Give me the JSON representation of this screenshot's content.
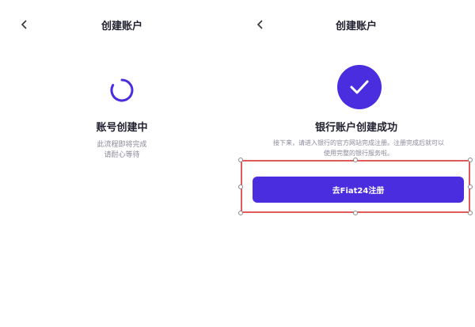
{
  "left_screen": {
    "back_icon": "chevron-left-icon",
    "title": "创建账户",
    "spinner_icon": "loading-spinner-icon",
    "status_title": "账号创建中",
    "desc_line1": "此流程即将完成",
    "desc_line2": "请耐心等待"
  },
  "right_screen": {
    "back_icon": "chevron-left-icon",
    "title": "创建账户",
    "success_icon": "checkmark-icon",
    "success_title": "银行账户创建成功",
    "desc_line1": "接下来，请进入银行的官方网站完成注册。注册完成后就可以",
    "desc_line2": "使用完整的银行服务啦。",
    "cta_label": "去Fiat24注册"
  },
  "colors": {
    "accent": "#4b2de0",
    "highlight_border": "#e05a5a",
    "muted_text": "#8a8a99"
  }
}
